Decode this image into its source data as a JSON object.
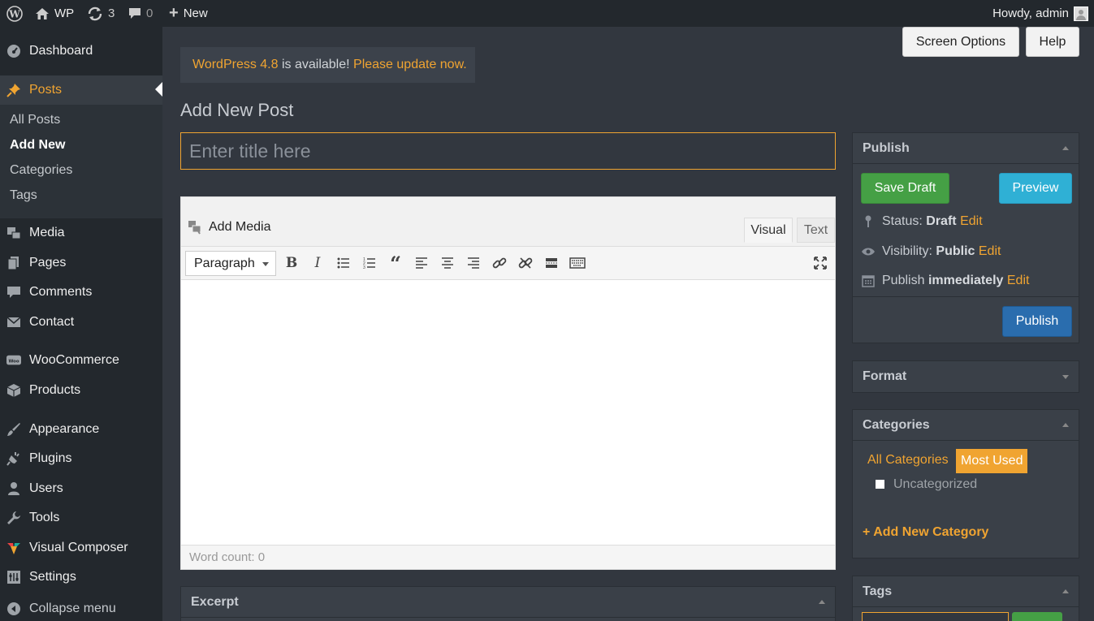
{
  "topbar": {
    "site_name": "WP",
    "updates_count": "3",
    "comments_count": "0",
    "new_label": "New",
    "howdy": "Howdy, admin"
  },
  "sidebar": {
    "items": [
      {
        "label": "Dashboard"
      },
      {
        "label": "Posts"
      },
      {
        "label": "Media"
      },
      {
        "label": "Pages"
      },
      {
        "label": "Comments"
      },
      {
        "label": "Contact"
      },
      {
        "label": "WooCommerce"
      },
      {
        "label": "Products"
      },
      {
        "label": "Appearance"
      },
      {
        "label": "Plugins"
      },
      {
        "label": "Users"
      },
      {
        "label": "Tools"
      },
      {
        "label": "Visual Composer"
      },
      {
        "label": "Settings"
      },
      {
        "label": "Collapse menu"
      }
    ],
    "submenu": [
      "All Posts",
      "Add New",
      "Categories",
      "Tags"
    ]
  },
  "header_buttons": {
    "screen_options": "Screen Options",
    "help": "Help"
  },
  "notice": {
    "version": "WordPress 4.8",
    "middle": " is available! ",
    "link": "Please update now."
  },
  "page_title": "Add New Post",
  "title_placeholder": "Enter title here",
  "editor": {
    "add_media": "Add Media",
    "tab_visual": "Visual",
    "tab_text": "Text",
    "format_select": "Paragraph",
    "word_count": "Word count: 0"
  },
  "excerpt": {
    "title": "Excerpt"
  },
  "publish": {
    "title": "Publish",
    "save_draft": "Save Draft",
    "preview": "Preview",
    "status_label": "Status:",
    "status_value": "Draft",
    "visibility_label": "Visibility:",
    "visibility_value": "Public",
    "publish_label": "Publish",
    "publish_value": "immediately",
    "edit": "Edit",
    "publish_button": "Publish"
  },
  "format": {
    "title": "Format"
  },
  "categories": {
    "title": "Categories",
    "tab_all": "All Categories",
    "tab_most_used": "Most Used",
    "item": "Uncategorized",
    "add_new": "+ Add New Category"
  },
  "tags": {
    "title": "Tags"
  },
  "colors": {
    "accent": "#f0a431",
    "adminbar": "#23282d",
    "background": "#32373f",
    "save_draft": "#45a045",
    "preview": "#2fb0d5",
    "publish": "#2a6dae"
  }
}
